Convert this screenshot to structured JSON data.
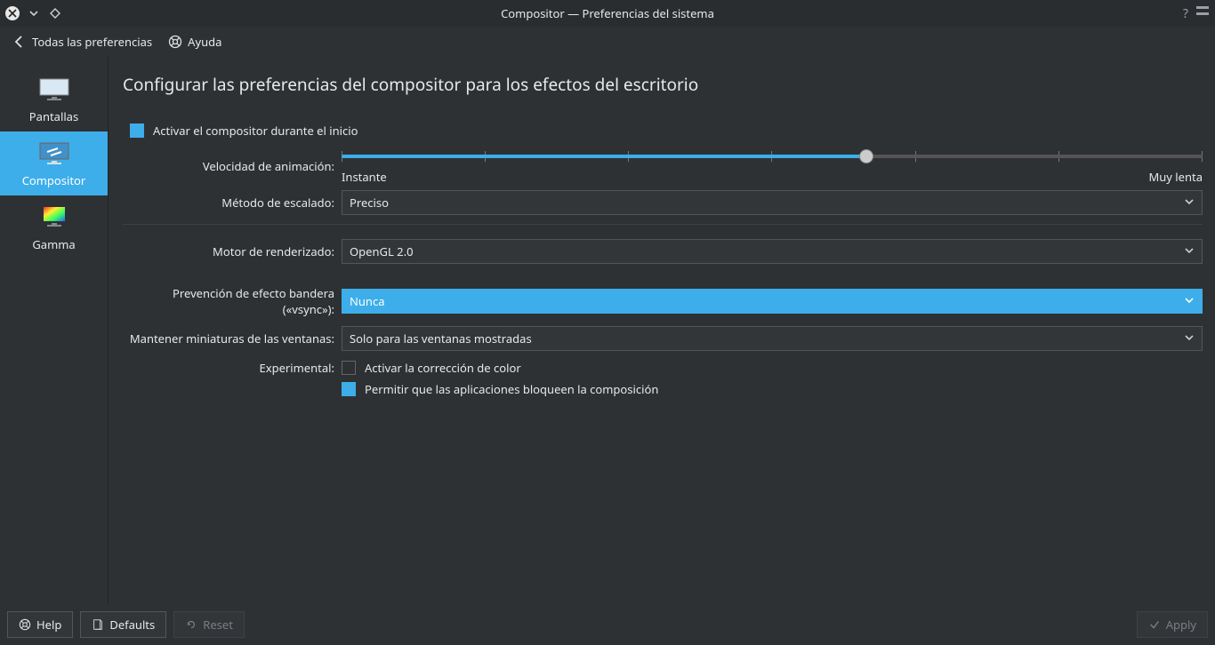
{
  "window": {
    "title": "Compositor — Preferencias del sistema"
  },
  "toolbar": {
    "back_label": "Todas las preferencias",
    "help_label": "Ayuda"
  },
  "sidebar": {
    "items": [
      {
        "id": "pantallas",
        "label": "Pantallas"
      },
      {
        "id": "compositor",
        "label": "Compositor"
      },
      {
        "id": "gamma",
        "label": "Gamma"
      }
    ],
    "active": "compositor"
  },
  "main": {
    "title": "Configurar las preferencias del compositor para los efectos del escritorio",
    "enable_on_startup": {
      "label": "Activar el compositor durante el inicio",
      "checked": true
    },
    "animation_speed": {
      "label": "Velocidad de animación:",
      "left_label": "Instante",
      "right_label": "Muy lenta",
      "value_percent": 61
    },
    "scale_method": {
      "label": "Método de escalado:",
      "value": "Preciso"
    },
    "rendering_backend": {
      "label": "Motor de renderizado:",
      "value": "OpenGL 2.0"
    },
    "vsync": {
      "label": "Prevención de efecto bandera («vsync»):",
      "value": "Nunca",
      "highlighted": true
    },
    "keep_thumbnails": {
      "label": "Mantener miniaturas de las ventanas:",
      "value": "Solo para las ventanas mostradas"
    },
    "experimental": {
      "label": "Experimental:",
      "color_correction": {
        "label": "Activar la corrección de color",
        "checked": false
      },
      "allow_block": {
        "label": "Permitir que las aplicaciones bloqueen la composición",
        "checked": true
      }
    }
  },
  "footer": {
    "help": "Help",
    "defaults": "Defaults",
    "reset": "Reset",
    "apply": "Apply"
  }
}
